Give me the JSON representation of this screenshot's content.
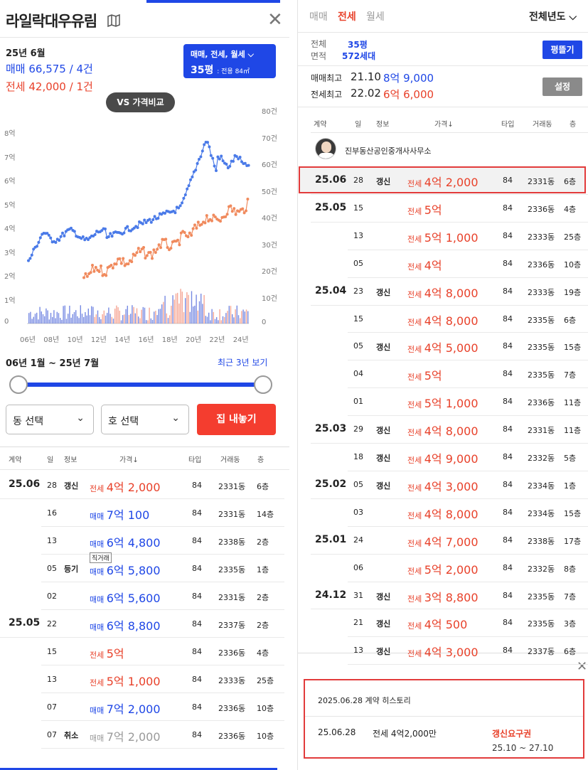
{
  "left": {
    "title": "라일락대우유림",
    "summary": {
      "month": "25년 6월",
      "sale_line": "매매 66,575 / 4건",
      "jeonse_line": "전세 42,000 / 1건"
    },
    "filter": {
      "types": "매매, 전세, 월세",
      "size": "35평",
      "size_detail": "전용 84㎡"
    },
    "vs_label": "VS 가격비교",
    "y_left_ticks": [
      "8억",
      "7억",
      "6억",
      "5억",
      "4억",
      "3억",
      "2억",
      "1억",
      "0"
    ],
    "y_right_ticks": [
      "80건",
      "70건",
      "60건",
      "50건",
      "40건",
      "30건",
      "20건",
      "10건",
      "0"
    ],
    "x_ticks": [
      "06년",
      "08년",
      "10년",
      "12년",
      "14년",
      "16년",
      "18년",
      "20년",
      "22년",
      "24년"
    ],
    "range_text": "06년 1월 ~ 25년 7월",
    "range_link": "최근 3년 보기",
    "dong_select": "동 선택",
    "ho_select": "호 선택",
    "sell_button": "집 내놓기",
    "table_headers": [
      "계약",
      "일",
      "정보",
      "가격↓",
      "타입",
      "거래동",
      "층"
    ],
    "rows": [
      {
        "month": "25.06",
        "day": "28",
        "info": "갱신",
        "kind": "전세",
        "price": "4억 2,000",
        "type": "84",
        "dong": "2331동",
        "floor": "6층",
        "color": "red"
      },
      {
        "month": "",
        "day": "16",
        "info": "",
        "kind": "매매",
        "price": "7억 100",
        "type": "84",
        "dong": "2331동",
        "floor": "14층",
        "color": "blue"
      },
      {
        "month": "",
        "day": "13",
        "info": "",
        "kind": "매매",
        "price": "6억 4,800",
        "type": "84",
        "dong": "2338동",
        "floor": "2층",
        "color": "blue"
      },
      {
        "month": "",
        "day": "05",
        "info": "등기",
        "kind": "매매",
        "price": "6억 5,800",
        "type": "84",
        "dong": "2335동",
        "floor": "1층",
        "color": "blue",
        "tag": "직거래"
      },
      {
        "month": "",
        "day": "02",
        "info": "",
        "kind": "매매",
        "price": "6억 5,600",
        "type": "84",
        "dong": "2331동",
        "floor": "2층",
        "color": "blue"
      },
      {
        "month": "25.05",
        "day": "22",
        "info": "",
        "kind": "매매",
        "price": "6억 8,800",
        "type": "84",
        "dong": "2337동",
        "floor": "2층",
        "color": "blue"
      },
      {
        "month": "",
        "day": "15",
        "info": "",
        "kind": "전세",
        "price": "5억",
        "type": "84",
        "dong": "2336동",
        "floor": "4층",
        "color": "red"
      },
      {
        "month": "",
        "day": "13",
        "info": "",
        "kind": "전세",
        "price": "5억 1,000",
        "type": "84",
        "dong": "2333동",
        "floor": "25층",
        "color": "red"
      },
      {
        "month": "",
        "day": "07",
        "info": "",
        "kind": "매매",
        "price": "7억 2,000",
        "type": "84",
        "dong": "2336동",
        "floor": "10층",
        "color": "blue"
      },
      {
        "month": "",
        "day": "07",
        "info": "취소",
        "kind": "매매",
        "price": "7억 2,000",
        "type": "84",
        "dong": "2336동",
        "floor": "10층",
        "color": "gray"
      }
    ]
  },
  "right": {
    "tabs": [
      "매매",
      "전세",
      "월세"
    ],
    "year_select": "전체년도",
    "area_label_1": "전체",
    "area_label_2": "면적",
    "area_size": "35평",
    "area_units": "572세대",
    "pyeong_button": "평뜰기",
    "sale_max_label": "매매최고",
    "sale_max_date": "21.10",
    "sale_max_price": "8억 9,000",
    "jeonse_max_label": "전세최고",
    "jeonse_max_date": "22.02",
    "jeonse_max_price": "6억 6,000",
    "settings_button": "설정",
    "table_headers": [
      "계약",
      "일",
      "정보",
      "가격↓",
      "타입",
      "거래동",
      "층"
    ],
    "agent": "진부동산공인중개사사무소",
    "rows": [
      {
        "month": "25.06",
        "day": "28",
        "info": "갱신",
        "price": "4억 2,000",
        "type": "84",
        "dong": "2331동",
        "floor": "6층"
      },
      {
        "month": "25.05",
        "day": "15",
        "info": "",
        "price": "5억",
        "type": "84",
        "dong": "2336동",
        "floor": "4층"
      },
      {
        "month": "",
        "day": "13",
        "info": "",
        "price": "5억 1,000",
        "type": "84",
        "dong": "2333동",
        "floor": "25층"
      },
      {
        "month": "",
        "day": "05",
        "info": "",
        "price": "4억",
        "type": "84",
        "dong": "2336동",
        "floor": "10층"
      },
      {
        "month": "25.04",
        "day": "23",
        "info": "갱신",
        "price": "4억 8,000",
        "type": "84",
        "dong": "2333동",
        "floor": "19층"
      },
      {
        "month": "",
        "day": "15",
        "info": "",
        "price": "4억 8,000",
        "type": "84",
        "dong": "2335동",
        "floor": "6층"
      },
      {
        "month": "",
        "day": "05",
        "info": "갱신",
        "price": "4억 5,000",
        "type": "84",
        "dong": "2335동",
        "floor": "15층"
      },
      {
        "month": "",
        "day": "04",
        "info": "",
        "price": "5억",
        "type": "84",
        "dong": "2335동",
        "floor": "7층"
      },
      {
        "month": "",
        "day": "01",
        "info": "",
        "price": "5억 1,000",
        "type": "84",
        "dong": "2336동",
        "floor": "11층"
      },
      {
        "month": "25.03",
        "day": "29",
        "info": "갱신",
        "price": "4억 8,000",
        "type": "84",
        "dong": "2331동",
        "floor": "11층"
      },
      {
        "month": "",
        "day": "18",
        "info": "갱신",
        "price": "4억 9,000",
        "type": "84",
        "dong": "2332동",
        "floor": "5층"
      },
      {
        "month": "25.02",
        "day": "05",
        "info": "갱신",
        "price": "4억 3,000",
        "type": "84",
        "dong": "2334동",
        "floor": "1층"
      },
      {
        "month": "",
        "day": "03",
        "info": "",
        "price": "4억 8,000",
        "type": "84",
        "dong": "2334동",
        "floor": "15층"
      },
      {
        "month": "25.01",
        "day": "24",
        "info": "",
        "price": "4억 7,000",
        "type": "84",
        "dong": "2338동",
        "floor": "17층"
      },
      {
        "month": "",
        "day": "06",
        "info": "",
        "price": "5억 2,000",
        "type": "84",
        "dong": "2332동",
        "floor": "8층"
      },
      {
        "month": "24.12",
        "day": "31",
        "info": "갱신",
        "price": "3억 8,800",
        "type": "84",
        "dong": "2335동",
        "floor": "7층"
      },
      {
        "month": "",
        "day": "21",
        "info": "갱신",
        "price": "4억 500",
        "type": "84",
        "dong": "2335동",
        "floor": "3층"
      },
      {
        "month": "",
        "day": "13",
        "info": "갱신",
        "price": "4억 3,000",
        "type": "84",
        "dong": "2337동",
        "floor": "6층"
      }
    ],
    "kind_label": "전세",
    "history": {
      "title": "2025.06.28 계약 히스토리",
      "date": "25.06.28",
      "detail": "전세 4억2,000만",
      "badge": "갱신요구권",
      "period": "25.10 ~ 27.10"
    }
  },
  "colors": {
    "blue": "#1f47e6",
    "red": "#e8412a",
    "orange": "#f08a5d",
    "series_sale": "#4a7ae8"
  }
}
